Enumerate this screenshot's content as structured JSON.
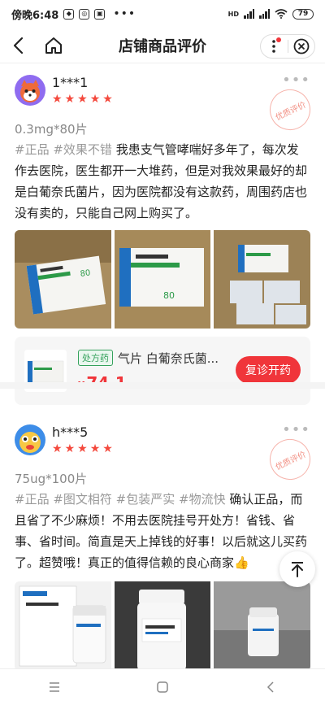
{
  "status_bar": {
    "carrier_time": "傍晚6:48",
    "network": "HD",
    "battery": "79"
  },
  "nav": {
    "title": "店铺商品评价"
  },
  "reviews": [
    {
      "username": "1***1",
      "rating": 5,
      "stamp": "优质评价",
      "spec": "0.3mg*80片",
      "tags": "#正品 #效果不错",
      "content": "我患支气管哮喘好多年了，每次发作去医院，医生都开一大堆药，但是对我效果最好的却是白葡奈氏菌片，因为医院都没有这款药，周围药店也没有卖的，只能自己网上购买了。",
      "product": {
        "badge": "处方药",
        "name": "气片 白葡奈氏菌...",
        "currency": "¥",
        "price": "74.1",
        "button": "复诊开药"
      }
    },
    {
      "username": "h***5",
      "rating": 5,
      "stamp": "优质评价",
      "spec": "75ug*100片",
      "tags": "#正品 #图文相符 #包装严实 #物流快",
      "content": "确认正品，而且省了不少麻烦！不用去医院挂号开处方！省钱、省事、省时间。简直是天上掉钱的好事！以后就这儿买药了。超赞哦！真正的值得信赖的良心商家👍"
    }
  ],
  "colors": {
    "accent": "#f0353a",
    "star": "#f4493d",
    "rx_green": "#35a25c"
  }
}
